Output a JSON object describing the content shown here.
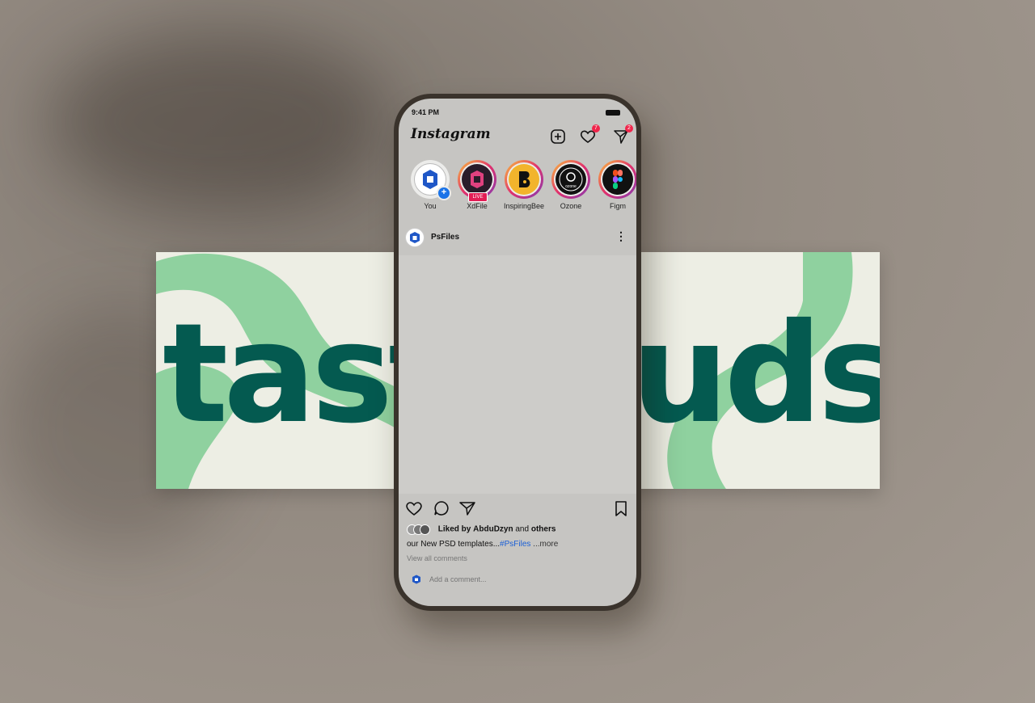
{
  "status_bar": {
    "time": "9:41 PM"
  },
  "app": {
    "name": "Instagram"
  },
  "header": {
    "notifications_count": "7",
    "messages_count": "2"
  },
  "stories": [
    {
      "label": "You"
    },
    {
      "label": "XdFile",
      "live": "LIVE"
    },
    {
      "label": "InspiringBee"
    },
    {
      "label": "Ozone",
      "logo_text": "ozone"
    },
    {
      "label": "Figm"
    }
  ],
  "post": {
    "username": "PsFiles",
    "menu_icon": "⋮",
    "image_text": "tastebuds",
    "liked_prefix": "Liked by",
    "liked_user": "AbduDzyn",
    "liked_and": "and",
    "liked_others": "others",
    "caption_text": "our New PSD templates...",
    "caption_hashtag": "#PsFiles",
    "caption_more": " ...more",
    "view_comments": "View all comments",
    "comment_placeholder": "Add a comment..."
  },
  "colors": {
    "brand_green": "#045a50",
    "accent_green": "#8fd19f",
    "banner_bg": "#edeee4",
    "instagram_badge": "#f0254b",
    "hashtag_blue": "#1a5fd6"
  }
}
